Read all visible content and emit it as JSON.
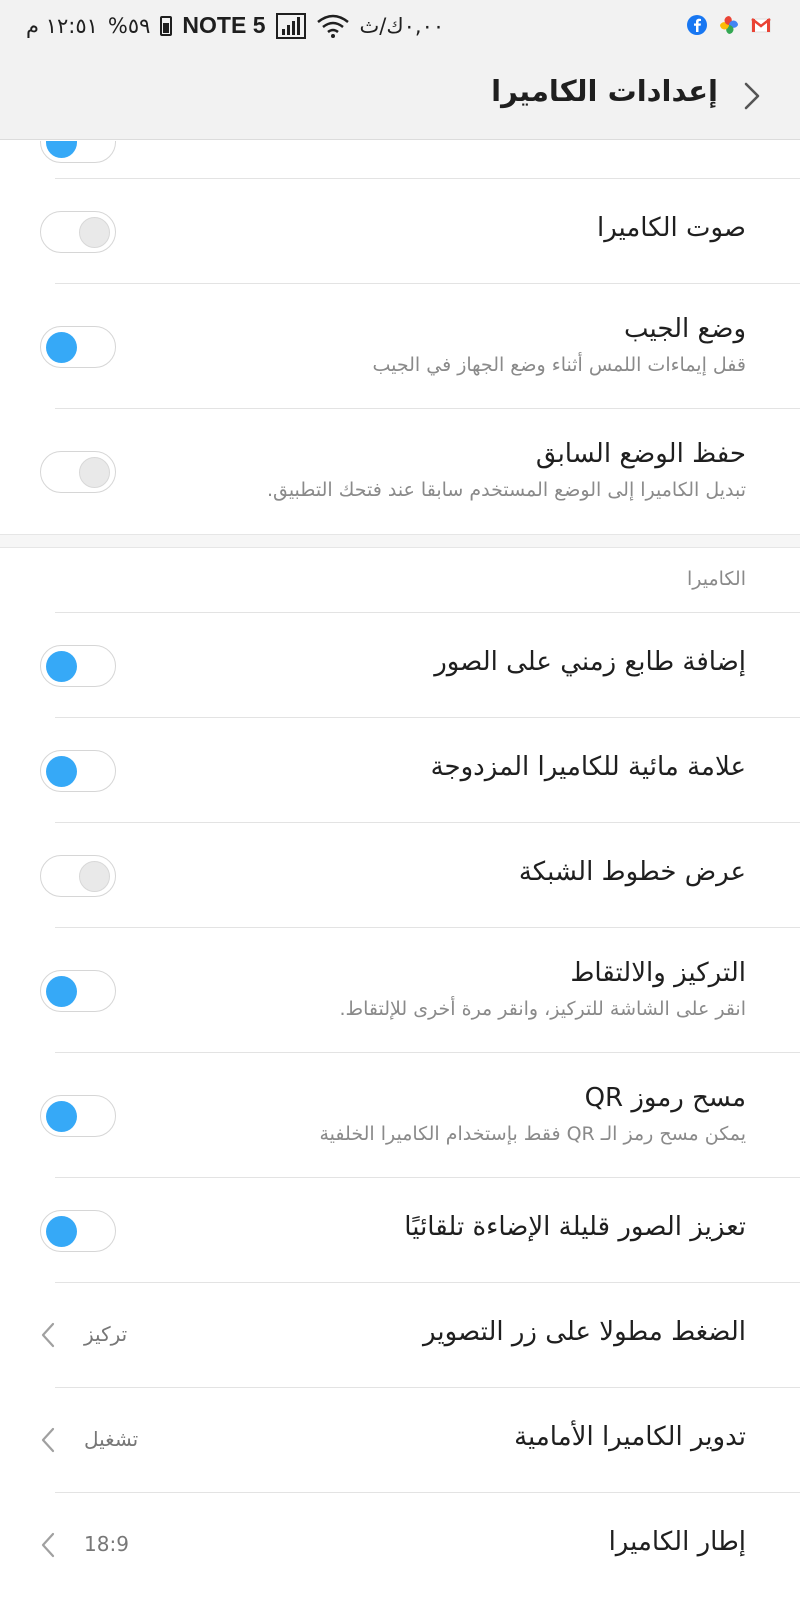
{
  "status_bar": {
    "time": "١٢:٥١ م",
    "battery_percent": "%٥٩",
    "carrier": "NOTE 5",
    "speed": "٠,٠٠ك/ث",
    "icons": [
      "battery-icon",
      "signal-icon",
      "wifi-icon",
      "facebook-icon",
      "photos-icon",
      "gmail-icon"
    ]
  },
  "header": {
    "title": "إعدادات الكاميرا"
  },
  "settings": [
    {
      "title": "صوت الكاميرا",
      "toggle_on": false
    },
    {
      "title": "وضع الجيب",
      "subtitle": "قفل إيماءات اللمس أثناء وضع الجهاز في الجيب",
      "toggle_on": true
    },
    {
      "title": "حفظ الوضع السابق",
      "subtitle": "تبديل الكاميرا إلى الوضع المستخدم سابقا عند فتحك التطبيق.",
      "toggle_on": false
    }
  ],
  "camera_section": {
    "header": "الكاميرا",
    "items": [
      {
        "title": "إضافة طابع زمني على الصور",
        "toggle_on": true
      },
      {
        "title": "علامة مائية للكاميرا المزدوجة",
        "toggle_on": true
      },
      {
        "title": "عرض خطوط الشبكة",
        "toggle_on": false
      },
      {
        "title": "التركيز والالتقاط",
        "subtitle": "انقر على الشاشة للتركيز، وانقر مرة أخرى للإلتقاط.",
        "toggle_on": true
      },
      {
        "title": "مسح رموز QR",
        "subtitle": "يمكن مسح رمز الـ QR فقط بإستخدام الكاميرا الخلفية",
        "toggle_on": true
      },
      {
        "title": "تعزيز الصور قليلة الإضاءة تلقائيًا",
        "toggle_on": true
      },
      {
        "title": "الضغط مطولا على زر التصوير",
        "value": "تركيز"
      },
      {
        "title": "تدوير الكاميرا الأمامية",
        "value": "تشغيل"
      },
      {
        "title": "إطار الكاميرا",
        "value": "18:9"
      }
    ]
  },
  "colors": {
    "accent": "#36a9f7",
    "header_bg": "#f2f2f2",
    "divider": "#e3e3e3",
    "subtitle": "#8a8a8a"
  }
}
